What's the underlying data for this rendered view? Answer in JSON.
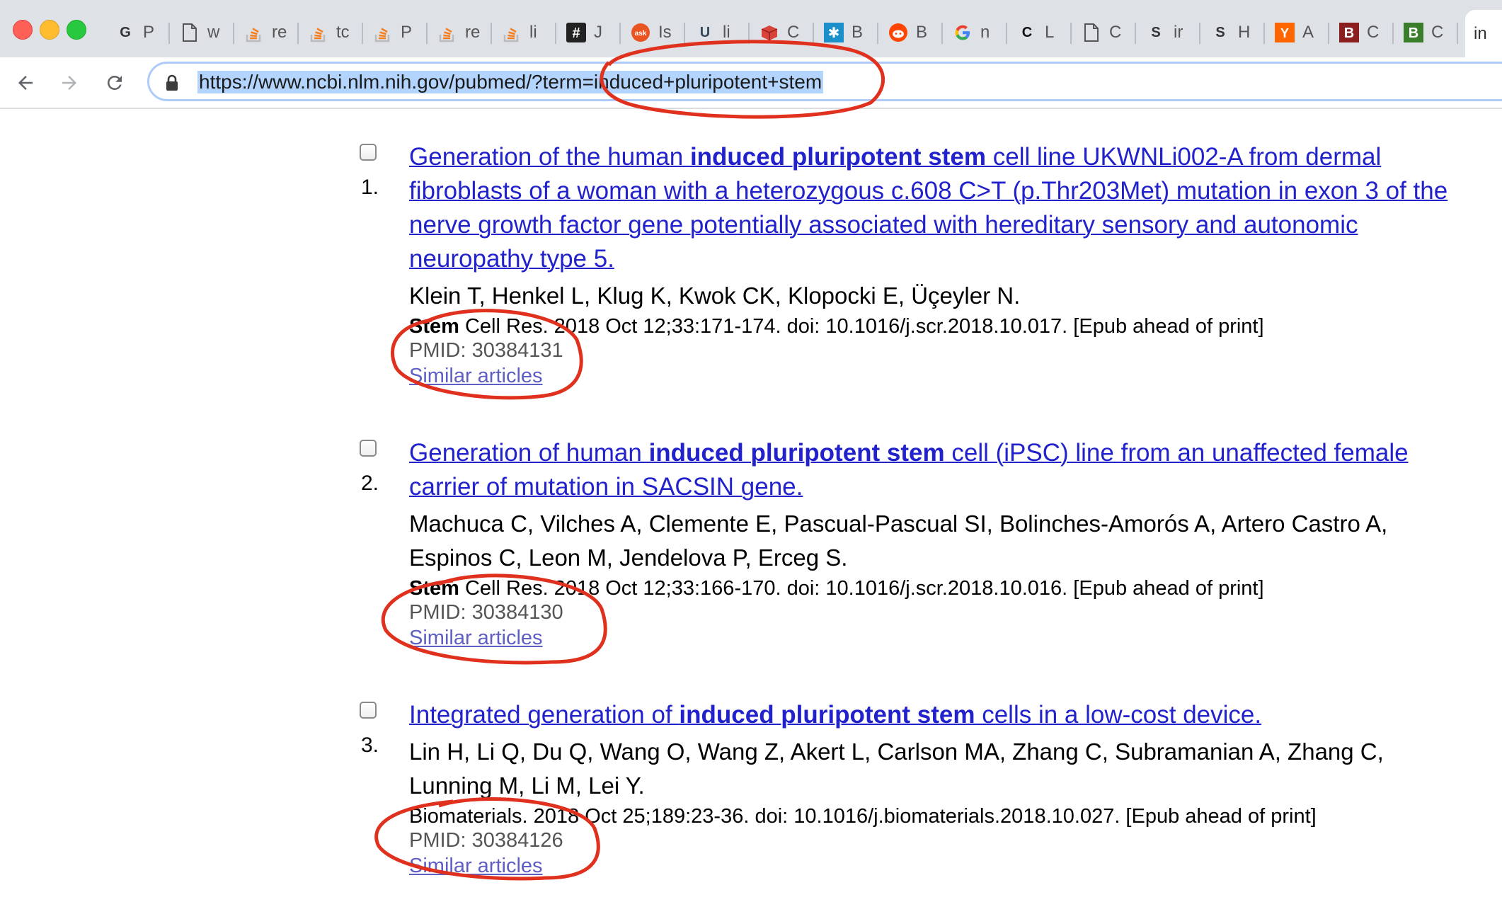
{
  "browser": {
    "tabs": [
      {
        "icon": "goodreads-icon",
        "glyph": "G",
        "title": "P",
        "color": "#333"
      },
      {
        "icon": "document-icon",
        "glyph": "",
        "title": "w",
        "color": "#555"
      },
      {
        "icon": "stackoverflow-icon",
        "glyph": "",
        "title": "re",
        "color": "#f48024"
      },
      {
        "icon": "stackoverflow-icon",
        "glyph": "",
        "title": "tc",
        "color": "#f48024"
      },
      {
        "icon": "stackoverflow-icon",
        "glyph": "",
        "title": "P",
        "color": "#f48024"
      },
      {
        "icon": "stackoverflow-icon",
        "glyph": "",
        "title": "re",
        "color": "#f48024"
      },
      {
        "icon": "stackoverflow-icon",
        "glyph": "",
        "title": "li",
        "color": "#f48024"
      },
      {
        "icon": "hashtag-icon",
        "glyph": "#",
        "title": "J",
        "color": "#222"
      },
      {
        "icon": "askubuntu-icon",
        "glyph": "ask",
        "title": "Is",
        "color": "#e95420"
      },
      {
        "icon": "unix-icon",
        "glyph": "U",
        "title": "li",
        "color": "#34495e"
      },
      {
        "icon": "package-icon",
        "glyph": "",
        "title": "C",
        "color": "#c0392b"
      },
      {
        "icon": "snowflake-icon",
        "glyph": "✱",
        "title": "B",
        "color": "#1a8fc9"
      },
      {
        "icon": "reddit-icon",
        "glyph": "",
        "title": "B",
        "color": "#ff4500"
      },
      {
        "icon": "google-icon",
        "glyph": "G",
        "title": "n",
        "color": "#4285f4"
      },
      {
        "icon": "lightning-icon",
        "glyph": "C",
        "title": "L",
        "color": "#111"
      },
      {
        "icon": "document-icon",
        "glyph": "",
        "title": "C",
        "color": "#555"
      },
      {
        "icon": "dna-icon",
        "glyph": "S",
        "title": "ir",
        "color": "#333"
      },
      {
        "icon": "dna-icon",
        "glyph": "S",
        "title": "H",
        "color": "#333"
      },
      {
        "icon": "ycombinator-icon",
        "glyph": "Y",
        "title": "A",
        "color": "#ff6600"
      },
      {
        "icon": "bookmark-b-icon",
        "glyph": "B",
        "title": "C",
        "color": "#8b1e1e"
      },
      {
        "icon": "bookmark-b-icon",
        "glyph": "B",
        "title": "C",
        "color": "#3a7d2a"
      }
    ],
    "active_tab": {
      "title": "in"
    },
    "url": "https://www.ncbi.nlm.nih.gov/pubmed/?term=induced+pluripotent+stem"
  },
  "results": [
    {
      "number": "1.",
      "title_lines": [
        [
          {
            "t": "Generation of the human ",
            "b": false
          },
          {
            "t": "induced pluripotent stem",
            "b": true
          },
          {
            "t": " cell line UKWNLi002-A from dermal",
            "b": false
          }
        ],
        [
          {
            "t": "fibroblasts of a woman with a heterozygous c.608 C>T (p.Thr203Met) mutation in exon 3 of the",
            "b": false
          }
        ],
        [
          {
            "t": "nerve growth factor gene potentially associated with hereditary sensory and autonomic",
            "b": false
          }
        ],
        [
          {
            "t": "neuropathy type 5.",
            "b": false
          }
        ]
      ],
      "author_lines": [
        "Klein T, Henkel L, Klug K, Kwok CK, Klopocki E, Üçeyler N."
      ],
      "journal": "Stem",
      "citation": "Cell Res. 2018 Oct 12;33:171-174. doi: 10.1016/j.scr.2018.10.017. [Epub ahead of print]",
      "pmid": "PMID: 30384131",
      "similar": "Similar articles"
    },
    {
      "number": "2.",
      "title_lines": [
        [
          {
            "t": "Generation of human ",
            "b": false
          },
          {
            "t": "induced pluripotent stem",
            "b": true
          },
          {
            "t": " cell (iPSC) line from an unaffected female",
            "b": false
          }
        ],
        [
          {
            "t": "carrier of mutation in SACSIN gene.",
            "b": false
          }
        ]
      ],
      "author_lines": [
        "Machuca C, Vilches A, Clemente E, Pascual-Pascual SI, Bolinches-Amorós A, Artero Castro A,",
        "Espinos C, Leon M, Jendelova P, Erceg S."
      ],
      "journal": "Stem",
      "citation": "Cell Res. 2018 Oct 12;33:166-170. doi: 10.1016/j.scr.2018.10.016. [Epub ahead of print]",
      "pmid": "PMID: 30384130",
      "similar": "Similar articles"
    },
    {
      "number": "3.",
      "title_lines": [
        [
          {
            "t": "Integrated generation of ",
            "b": false
          },
          {
            "t": "induced pluripotent stem",
            "b": true
          },
          {
            "t": " cells in a low-cost device.",
            "b": false
          }
        ]
      ],
      "author_lines": [
        "Lin H, Li Q, Du Q, Wang O, Wang Z, Akert L, Carlson MA, Zhang C, Subramanian A, Zhang C,",
        "Lunning M, Li M, Lei Y."
      ],
      "journal": "",
      "citation": "Biomaterials. 2018 Oct 25;189:23-36. doi: 10.1016/j.biomaterials.2018.10.027. [Epub ahead of print]",
      "pmid": "PMID: 30384126",
      "similar": "Similar articles"
    }
  ],
  "annotation_color": "#e0301e"
}
